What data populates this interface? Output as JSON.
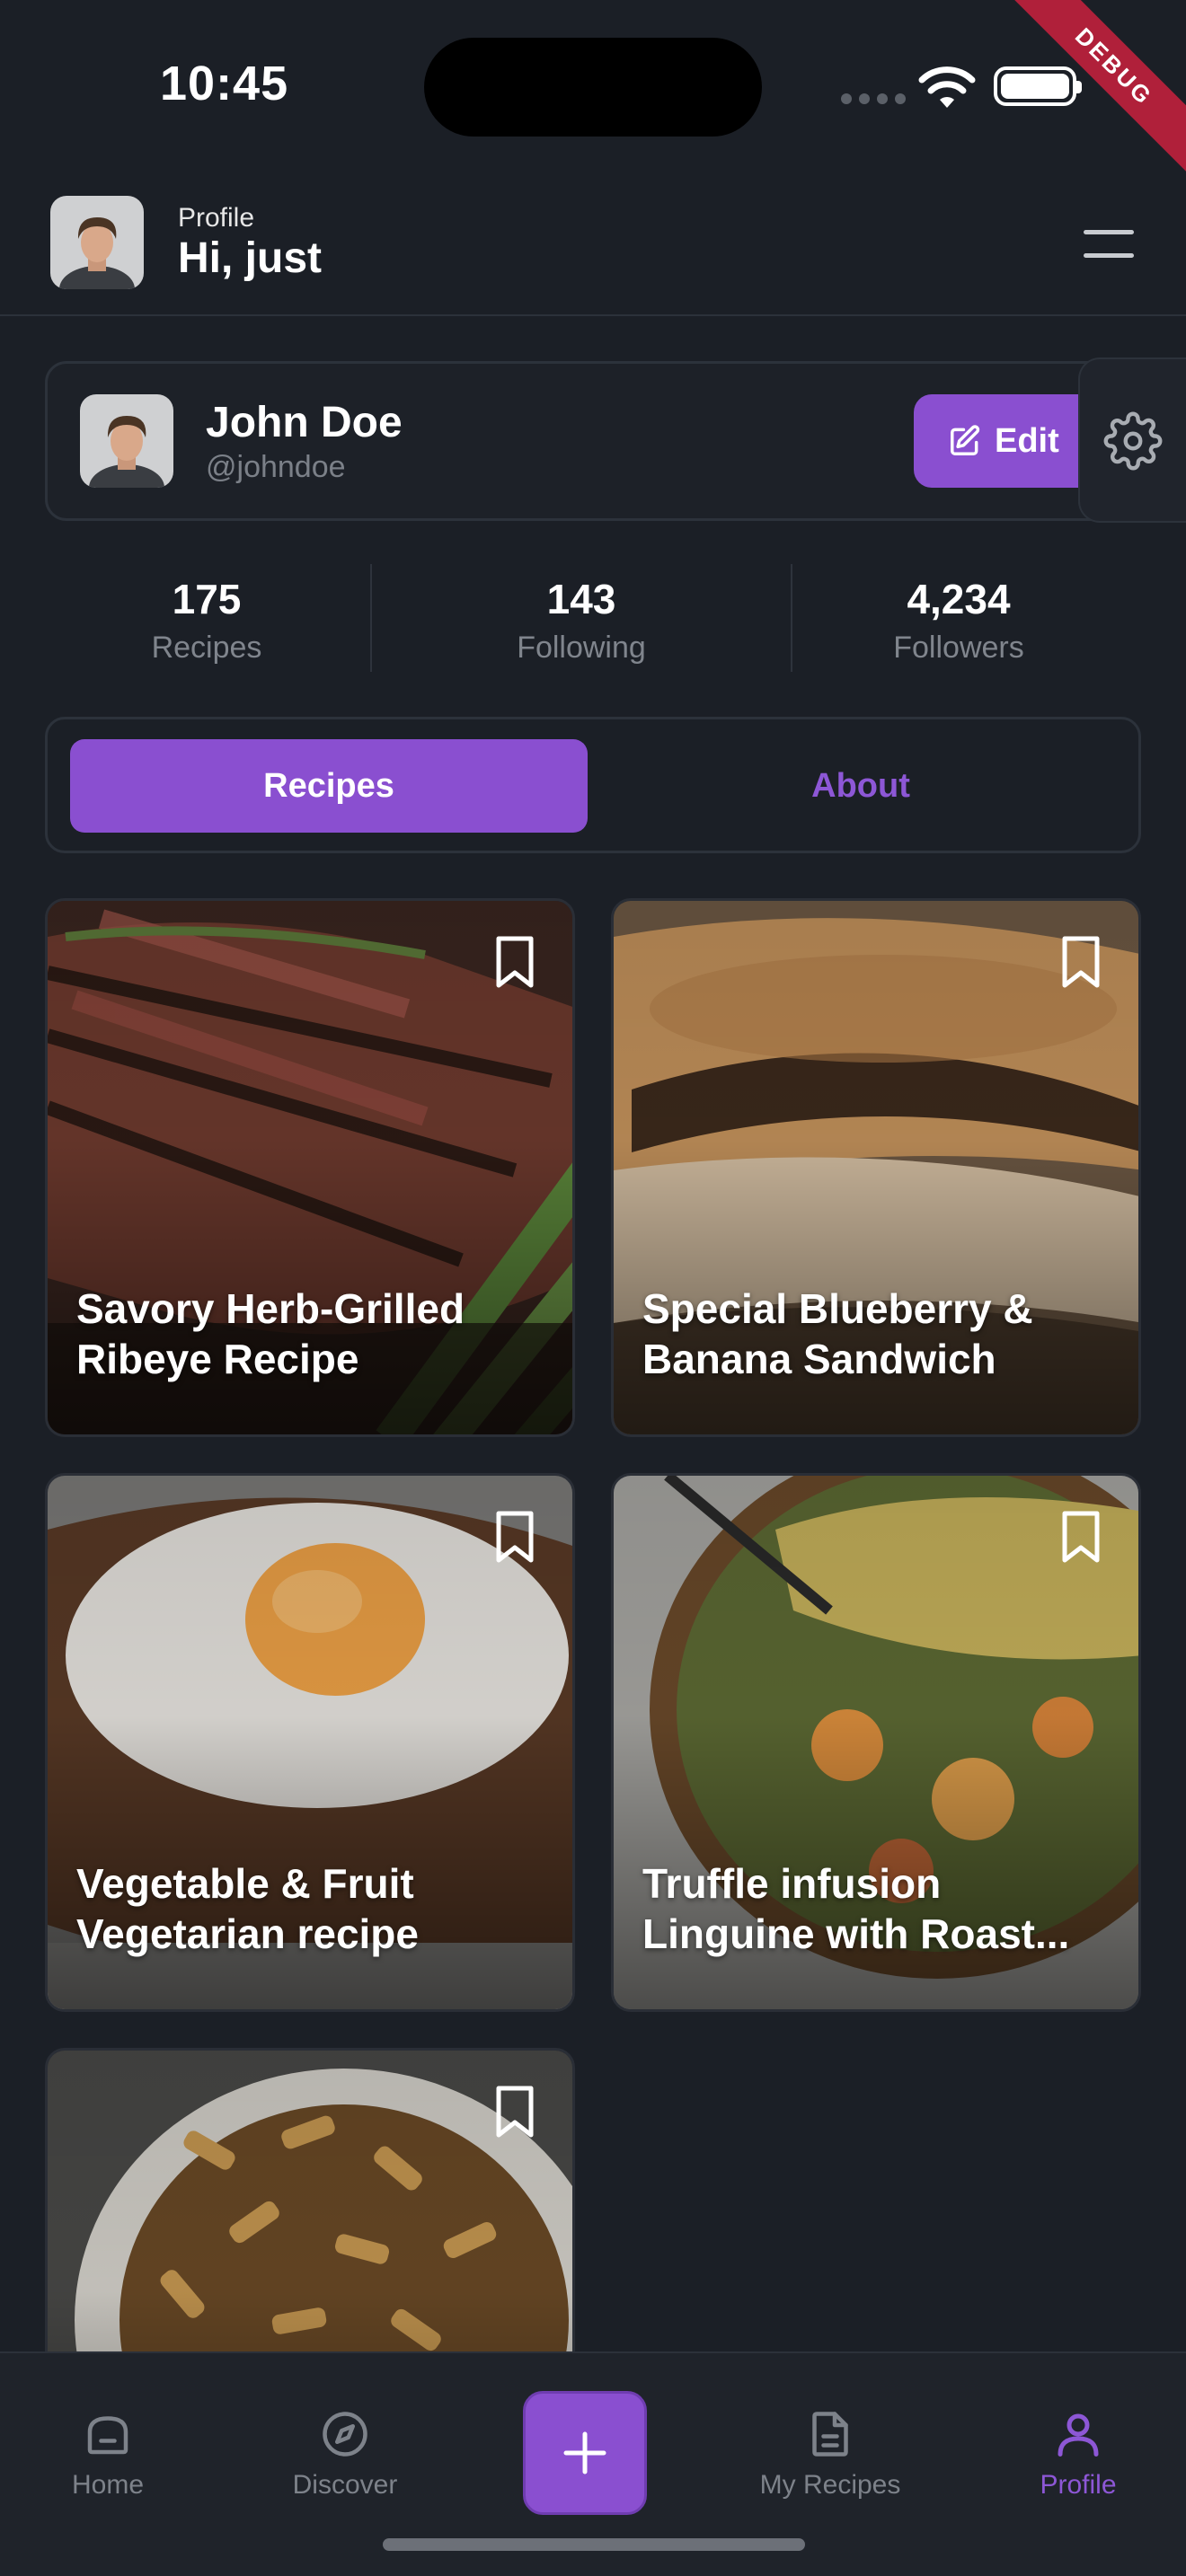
{
  "status_bar": {
    "time": "10:45",
    "debug_label": "DEBUG"
  },
  "header": {
    "subtitle": "Profile",
    "title": "Hi, just"
  },
  "profile": {
    "name": "John Doe",
    "handle": "@johndoe",
    "edit_label": "Edit"
  },
  "stats": [
    {
      "value": "175",
      "label": "Recipes"
    },
    {
      "value": "143",
      "label": "Following"
    },
    {
      "value": "4,234",
      "label": "Followers"
    }
  ],
  "tabs": {
    "active": "Recipes",
    "inactive": "About"
  },
  "recipes": [
    {
      "title": "Savory Herb-Grilled Ribeye Recipe"
    },
    {
      "title": "Special Blueberry & Banana Sandwich"
    },
    {
      "title": "Vegetable & Fruit Vegetarian recipe"
    },
    {
      "title": "Truffle infusion Linguine with Roast..."
    },
    {
      "title": ""
    }
  ],
  "nav": {
    "home": "Home",
    "discover": "Discover",
    "my_recipes": "My Recipes",
    "profile": "Profile"
  },
  "colors": {
    "accent": "#8a4fd0",
    "background": "#1b1f26"
  }
}
